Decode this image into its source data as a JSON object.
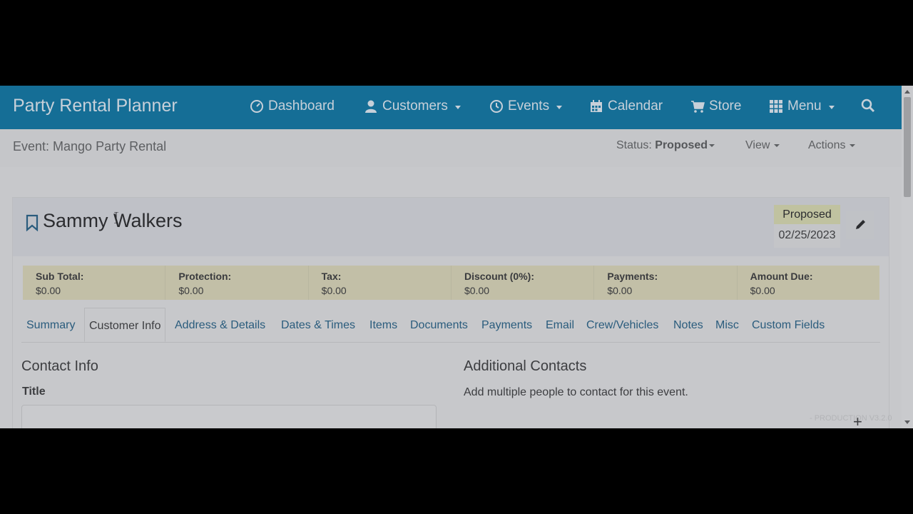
{
  "navbar": {
    "brand": "Party Rental Planner",
    "items": [
      {
        "label": "Dashboard",
        "icon": "dashboard-icon",
        "dropdown": false
      },
      {
        "label": "Customers",
        "icon": "user-icon",
        "dropdown": true
      },
      {
        "label": "Events",
        "icon": "clock-icon",
        "dropdown": true
      },
      {
        "label": "Calendar",
        "icon": "calendar-icon",
        "dropdown": false
      },
      {
        "label": "Store",
        "icon": "cart-icon",
        "dropdown": false
      },
      {
        "label": "Menu",
        "icon": "grid-icon",
        "dropdown": true
      }
    ],
    "search_icon": "search-icon"
  },
  "subheader": {
    "event_title": "Event: Mango Party Rental",
    "status_prefix": "Status:",
    "status_value": "Proposed",
    "view_label": "View",
    "actions_label": "Actions"
  },
  "card": {
    "customer_name": "Sammy Walkers",
    "status_badge": "Proposed",
    "status_date": "02/25/2023"
  },
  "totals": [
    {
      "label": "Sub Total:",
      "value": "$0.00"
    },
    {
      "label": "Protection:",
      "value": "$0.00"
    },
    {
      "label": "Tax:",
      "value": "$0.00"
    },
    {
      "label": "Discount (0%):",
      "value": "$0.00"
    },
    {
      "label": "Payments:",
      "value": "$0.00"
    },
    {
      "label": "Amount Due:",
      "value": "$0.00"
    }
  ],
  "tabs": [
    {
      "label": "Summary",
      "active": false
    },
    {
      "label": "Customer Info",
      "active": true
    },
    {
      "label": "Address & Details",
      "active": false
    },
    {
      "label": "Dates & Times",
      "active": false
    },
    {
      "label": "Items",
      "active": false
    },
    {
      "label": "Documents",
      "active": false
    },
    {
      "label": "Payments",
      "active": false
    },
    {
      "label": "Email",
      "active": false
    },
    {
      "label": "Crew/Vehicles",
      "active": false
    },
    {
      "label": "Notes",
      "active": false
    },
    {
      "label": "Misc",
      "active": false
    },
    {
      "label": "Custom Fields",
      "active": false
    }
  ],
  "contact_info": {
    "heading": "Contact Info",
    "title_label": "Title",
    "title_value": ""
  },
  "additional_contacts": {
    "heading": "Additional Contacts",
    "description": "Add multiple people to contact for this event."
  },
  "footer": {
    "production_tag": "- PRODUCTION V3.2.0",
    "add_symbol": "+"
  },
  "colors": {
    "navbar_bg": "#156e96",
    "link": "#2a5c7d",
    "totals_bg": "#c2bfa7",
    "status_badge_bg": "#c0c2a0"
  }
}
